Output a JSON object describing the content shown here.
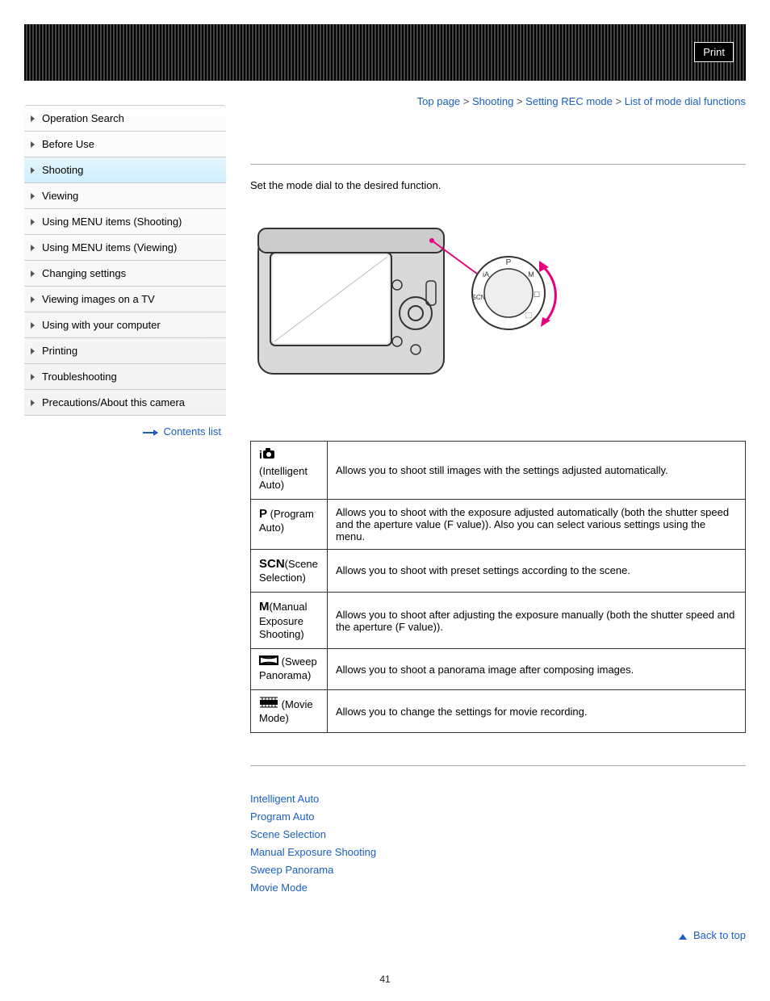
{
  "print_label": "Print",
  "breadcrumb": {
    "items": [
      "Top page",
      "Shooting",
      "Setting REC mode",
      "List of mode dial functions"
    ]
  },
  "sidebar": {
    "items": [
      "Operation Search",
      "Before Use",
      "Shooting",
      "Viewing",
      "Using MENU items (Shooting)",
      "Using MENU items (Viewing)",
      "Changing settings",
      "Viewing images on a TV",
      "Using with your computer",
      "Printing",
      "Troubleshooting",
      "Precautions/About this camera"
    ],
    "active_index": 2,
    "contents_list_label": "Contents list"
  },
  "intro_text": "Set the mode dial to the desired function.",
  "modes": [
    {
      "label": "(Intelligent Auto)",
      "desc": "Allows you to shoot still images with the settings adjusted automatically."
    },
    {
      "label": "(Program Auto)",
      "desc": "Allows you to shoot with the exposure adjusted automatically (both the shutter speed and the aperture value (F value)). Also you can select various settings using the menu."
    },
    {
      "label": "(Scene Selection)",
      "desc": "Allows you to shoot with preset settings according to the scene."
    },
    {
      "label": "(Manual Exposure Shooting)",
      "desc": "Allows you to shoot after adjusting the exposure manually (both the shutter speed and the aperture (F value))."
    },
    {
      "label": "(Sweep Panorama)",
      "desc": "Allows you to shoot a panorama image after composing images."
    },
    {
      "label": "(Movie Mode)",
      "desc": "Allows you to change the settings for movie recording."
    }
  ],
  "mode_icons": [
    "iA",
    "P",
    "SCN",
    "M",
    "PANO",
    "MOVIE"
  ],
  "related_links": [
    "Intelligent Auto",
    "Program Auto",
    "Scene Selection",
    "Manual Exposure Shooting",
    "Sweep Panorama",
    "Movie Mode"
  ],
  "back_to_top_label": "Back to top",
  "page_number": "41"
}
